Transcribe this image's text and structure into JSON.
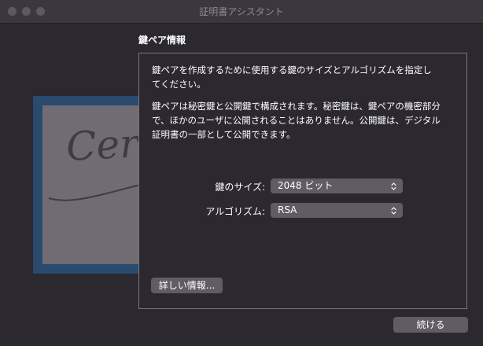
{
  "window": {
    "title": "証明書アシスタント"
  },
  "certificate_image": {
    "watermark_text": "Certificate"
  },
  "section": {
    "title": "鍵ペア情報"
  },
  "panel": {
    "paragraph1_lines": [
      "鍵ペアを作成するために使用する鍵のサイズとアルゴリズムを指定し",
      "てください。"
    ],
    "paragraph2_lines": [
      "鍵ペアは秘密鍵と公開鍵で構成されます。秘密鍵は、鍵ペアの機密部分",
      "で、ほかのユーザに公開されることはありません。公開鍵は、デジタル",
      "証明書の一部として公開できます。"
    ],
    "key_size": {
      "label": "鍵のサイズ:",
      "value": "2048 ビット"
    },
    "algorithm": {
      "label": "アルゴリズム:",
      "value": "RSA"
    },
    "more_info_button": "詳しい情報..."
  },
  "footer": {
    "continue_button": "続ける"
  },
  "colors": {
    "window_bg": "#2b2830",
    "titlebar_bg": "#3a373e",
    "control_bg": "#5f5c63",
    "panel_border": "#78757c",
    "cert_frame": "#2a4a6e"
  }
}
